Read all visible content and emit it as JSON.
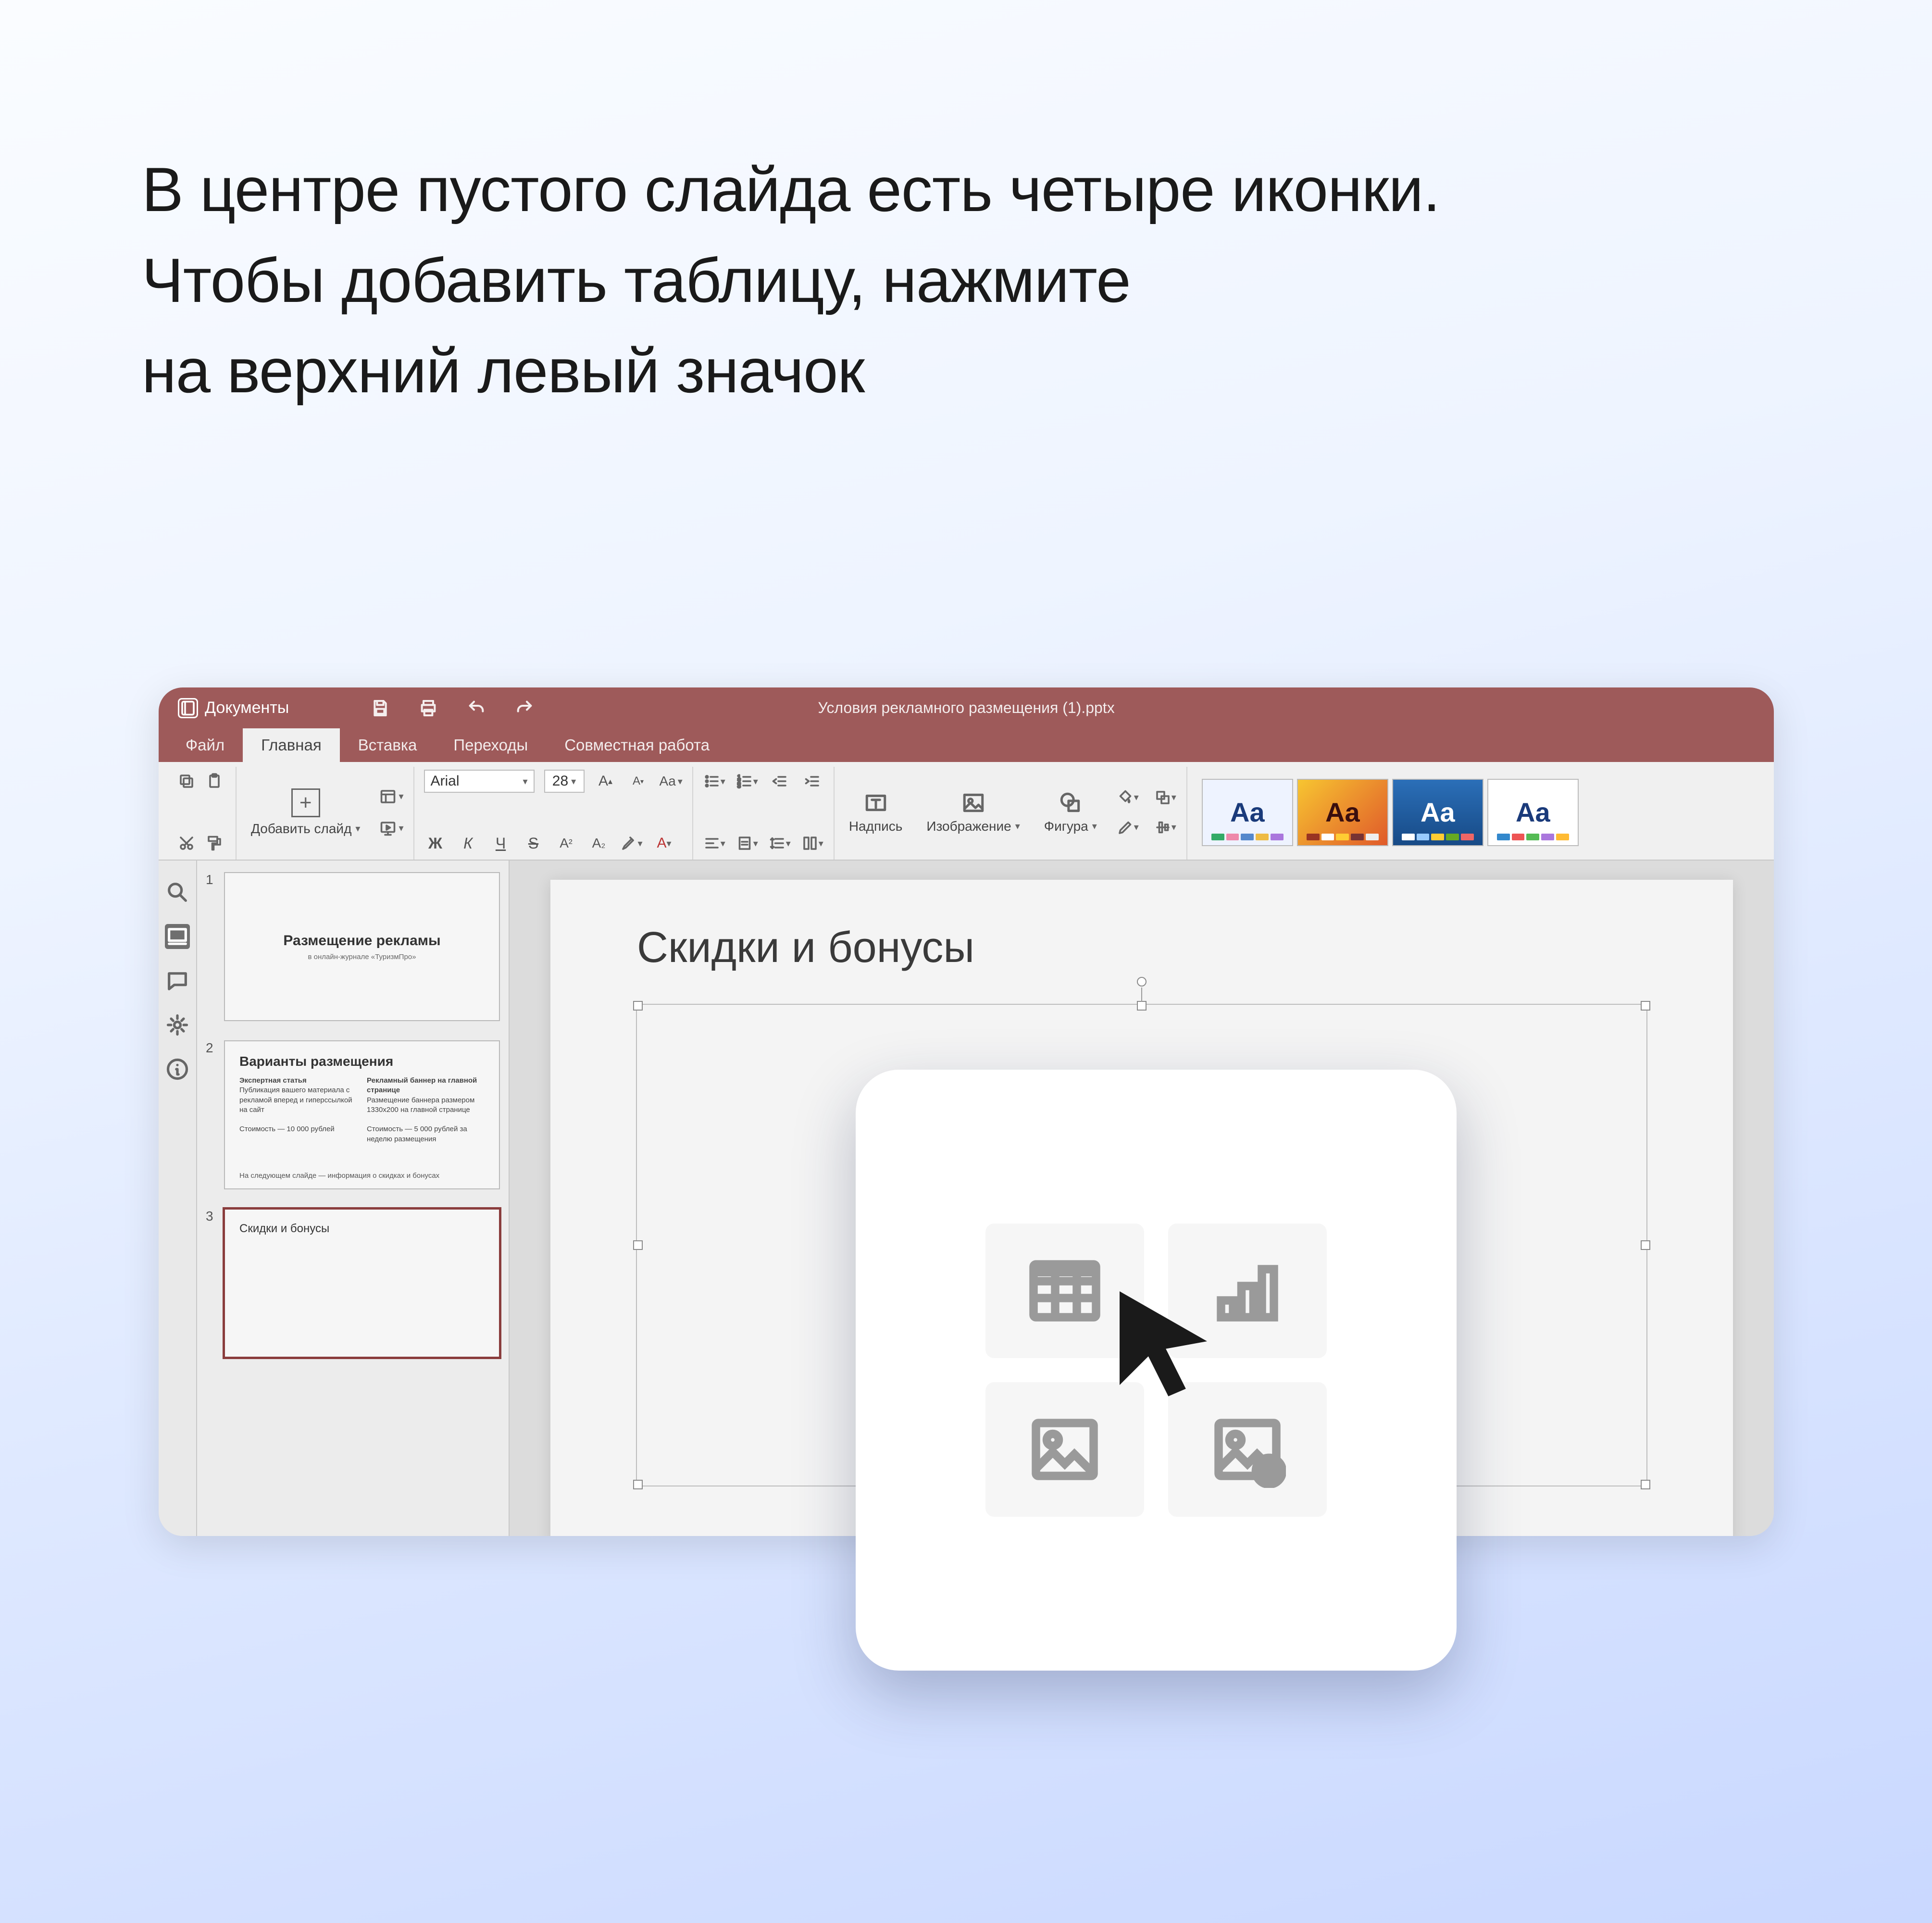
{
  "instruction": {
    "line1": "В центре пустого слайда есть четыре иконки.",
    "line2": "Чтобы добавить таблицу, нажмите",
    "line3": "на верхний левый значок"
  },
  "titlebar": {
    "brand": "Документы",
    "doc_title": "Условия рекламного размещения (1).pptx"
  },
  "menubar": {
    "tabs": [
      "Файл",
      "Главная",
      "Вставка",
      "Переходы",
      "Совместная работа"
    ],
    "active_index": 1
  },
  "ribbon": {
    "add_slide": "Добавить слайд",
    "font_name": "Arial",
    "font_size": "28",
    "caption": "Надпись",
    "image": "Изображение",
    "shape": "Фигура",
    "themes": [
      "Aa",
      "Aa",
      "Aa",
      "Aa"
    ]
  },
  "thumbnails": [
    {
      "num": "1",
      "title": "Размещение рекламы",
      "subtitle": "в онлайн-журнале «ТуризмПро»"
    },
    {
      "num": "2",
      "title": "Варианты размещения",
      "col1_h": "Экспертная статья",
      "col1_b": "Публикация вашего материала с рекламой вперед и гиперссылкой на сайт",
      "col1_p": "Стоимость — 10 000 рублей",
      "col2_h": "Рекламный баннер на главной странице",
      "col2_b": "Размещение баннера размером 1330х200 на главной странице",
      "col2_p": "Стоимость — 5 000 рублей за неделю размещения",
      "footer": "На следующем слайде — информация о скидках и бонусах"
    },
    {
      "num": "3",
      "title": "Скидки и бонусы"
    }
  ],
  "slide": {
    "title": "Скидки и бонусы"
  },
  "callout_icons": [
    "table-icon",
    "chart-icon",
    "picture-icon",
    "online-picture-icon"
  ]
}
